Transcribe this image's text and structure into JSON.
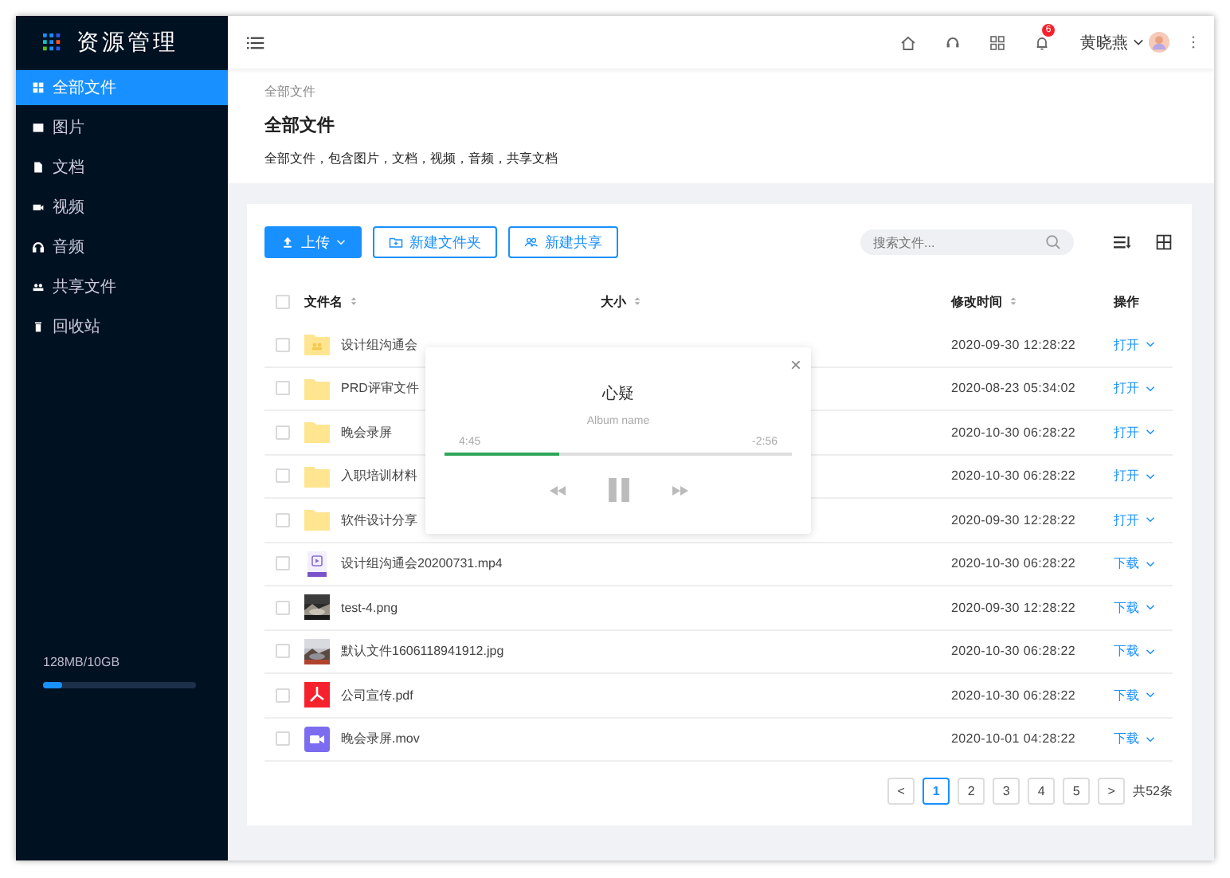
{
  "app": {
    "title": "资源管理"
  },
  "sidebar": {
    "items": [
      {
        "label": "全部文件",
        "selected": true
      },
      {
        "label": "图片",
        "selected": false
      },
      {
        "label": "文档",
        "selected": false
      },
      {
        "label": "视频",
        "selected": false
      },
      {
        "label": "音频",
        "selected": false
      },
      {
        "label": "共享文件",
        "selected": false
      },
      {
        "label": "回收站",
        "selected": false
      }
    ],
    "storage": {
      "text": "128MB/10GB",
      "level": 0.12
    }
  },
  "header": {
    "notifications": "6",
    "user": "黄晓燕"
  },
  "page": {
    "breadcrumb": "全部文件",
    "title": "全部文件",
    "description": "全部文件，包含图片，文档，视频，音频，共享文档"
  },
  "toolbar": {
    "buttons": [
      {
        "label": "上传",
        "kind": "primary"
      },
      {
        "label": "新建文件夹",
        "kind": "folder"
      },
      {
        "label": "新建共享",
        "kind": "share"
      }
    ],
    "search": {
      "placeholder": "搜索文件..."
    }
  },
  "table": {
    "all_checked": false,
    "columns": [
      {
        "label": "文件名",
        "sortable": true
      },
      {
        "label": "大小",
        "sortable": true
      },
      {
        "label": "修改时间",
        "sortable": true
      },
      {
        "label": "操作",
        "sortable": false
      }
    ],
    "rows": [
      {
        "checked": false,
        "kind": "shared-folder",
        "name": "设计组沟通会",
        "modified": "2020-09-30  12:28:22",
        "action": "打开"
      },
      {
        "checked": false,
        "kind": "folder",
        "name": "PRD评审文件",
        "modified": "2020-08-23 05:34:02",
        "action": "打开"
      },
      {
        "checked": false,
        "kind": "folder",
        "name": "晚会录屏",
        "modified": "2020-10-30  06:28:22",
        "action": "打开"
      },
      {
        "checked": false,
        "kind": "folder",
        "name": "入职培训材料",
        "modified": "2020-10-30  06:28:22",
        "action": "打开"
      },
      {
        "checked": false,
        "kind": "folder",
        "name": "软件设计分享",
        "modified": "2020-09-30  12:28:22",
        "action": "打开"
      },
      {
        "checked": false,
        "kind": "video",
        "name": "设计组沟通会20200731.mp4",
        "modified": "2020-10-30  06:28:22",
        "action": "下载"
      },
      {
        "checked": false,
        "kind": "picture",
        "name": "test-4.png",
        "modified": "2020-09-30  12:28:22",
        "action": "下载"
      },
      {
        "checked": false,
        "kind": "picture",
        "name": "默认文件1606118941912.jpg",
        "modified": "2020-10-30  06:28:22",
        "action": "下载"
      },
      {
        "checked": false,
        "kind": "pdf",
        "name": "公司宣传.pdf",
        "modified": "2020-10-30  06:28:22",
        "action": "下载"
      },
      {
        "checked": false,
        "kind": "movie",
        "name": "晚会录屏.mov",
        "modified": "2020-10-01  04:28:22",
        "action": "下载"
      }
    ]
  },
  "pagination": {
    "prev": "<",
    "pages": [
      {
        "label": "1",
        "selected": true
      },
      {
        "label": "2",
        "selected": false
      },
      {
        "label": "3",
        "selected": false
      },
      {
        "label": "4",
        "selected": false
      },
      {
        "label": "5",
        "selected": false
      }
    ],
    "next": ">",
    "total": "共52条"
  },
  "player": {
    "close": "×",
    "title": "心疑",
    "album": "Album name",
    "elapsed": "4:45",
    "remaining": "-2:56",
    "level": 0.33,
    "playing": true
  }
}
